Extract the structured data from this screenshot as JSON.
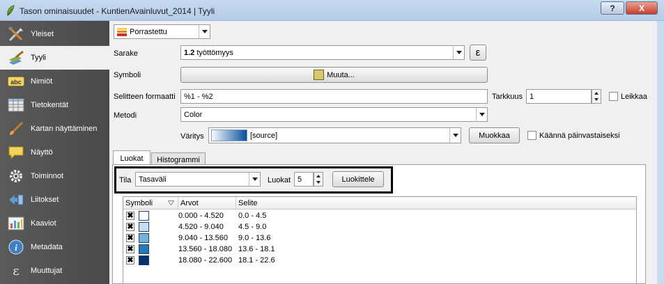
{
  "window": {
    "title": "Tason ominaisuudet - KuntienAvainluvut_2014 | Tyyli",
    "help_label": "?",
    "close_label": "X"
  },
  "sidebar": {
    "items": [
      {
        "label": "Yleiset",
        "icon": "tools-icon"
      },
      {
        "label": "Tyyli",
        "icon": "paintbrush-icon",
        "active": true
      },
      {
        "label": "Nimiöt",
        "icon": "abc-label-icon"
      },
      {
        "label": "Tietokentät",
        "icon": "table-icon"
      },
      {
        "label": "Kartan näyttäminen",
        "icon": "brush-icon"
      },
      {
        "label": "Näyttö",
        "icon": "speech-bubble-icon"
      },
      {
        "label": "Toiminnot",
        "icon": "gear-icon"
      },
      {
        "label": "Liitokset",
        "icon": "join-arrow-icon"
      },
      {
        "label": "Kaaviot",
        "icon": "chart-icon"
      },
      {
        "label": "Metadata",
        "icon": "info-icon"
      },
      {
        "label": "Muuttujat",
        "icon": "epsilon-icon"
      }
    ]
  },
  "renderer": {
    "value": "Porrastettu"
  },
  "column": {
    "label": "Sarake",
    "prefix": "1.2",
    "value": "työttömyys",
    "expr_symbol": "ε"
  },
  "symbol": {
    "label": "Symboli",
    "button_label": "Muuta...",
    "swatch_color": "#d8c86b"
  },
  "legend_format": {
    "label": "Selitteen formaatti",
    "value": "%1 - %2"
  },
  "precision": {
    "label": "Tarkkuus",
    "value": "1"
  },
  "trim": {
    "label": "Leikkaa"
  },
  "method": {
    "label": "Metodi",
    "value": "Color"
  },
  "color_ramp": {
    "label": "Väritys",
    "value": "[source]",
    "edit_label": "Muokkaa",
    "invert_label": "Käännä päinvastaiseksi"
  },
  "tabs": [
    {
      "label": "Luokat",
      "active": true
    },
    {
      "label": "Histogrammi"
    }
  ],
  "classes": {
    "mode_label": "Tila",
    "mode_value": "Tasaväli",
    "count_label": "Luokat",
    "count_value": "5",
    "classify_label": "Luokittele"
  },
  "table": {
    "headers": [
      "Symboli",
      "Arvot",
      "Selite"
    ],
    "rows": [
      {
        "values": "0.000 - 4.520",
        "legend": "0.0 - 4.5",
        "color": "#f7fbff"
      },
      {
        "values": "4.520 - 9.040",
        "legend": "4.5 - 9.0",
        "color": "#c7dcef"
      },
      {
        "values": "9.040 - 13.560",
        "legend": "9.0 - 13.6",
        "color": "#72b2d7"
      },
      {
        "values": "13.560 - 18.080",
        "legend": "13.6 - 18.1",
        "color": "#2878b8"
      },
      {
        "values": "18.080 - 22.600",
        "legend": "18.1 - 22.6",
        "color": "#08306b"
      }
    ]
  }
}
